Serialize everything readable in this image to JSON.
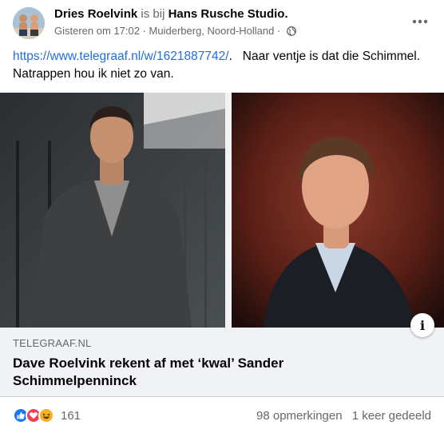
{
  "header": {
    "author": "Dries Roelvink",
    "connector": "is bij",
    "place": "Hans Rusche Studio",
    "period": ".",
    "timestamp": "Gisteren om 17:02",
    "separator": "·",
    "location": "Muiderberg, Noord-Holland",
    "privacy_icon": "globe-icon",
    "more_icon": "more-horizontal-icon"
  },
  "post": {
    "link": "https://www.telegraaf.nl/w/1621887742/",
    "link_suffix": ".",
    "text": "Naar ventje is dat die Schimmel. Natrappen hou ik niet zo van."
  },
  "preview": {
    "domain": "TELEGRAAF.NL",
    "title": "Dave Roelvink rekent af met ‘kwal’ Sander Schimmelpenninck",
    "info_label": "i"
  },
  "footer": {
    "reaction_icons": [
      "like-icon",
      "love-icon",
      "haha-icon"
    ],
    "reaction_count": "161",
    "comments": "98 opmerkingen",
    "shares": "1 keer gedeeld"
  },
  "colors": {
    "link": "#216fdb",
    "muted": "#65676b",
    "like": "#1877f2",
    "love": "#f33e58",
    "haha": "#f7b125",
    "preview_bg": "#f0f2f5"
  }
}
